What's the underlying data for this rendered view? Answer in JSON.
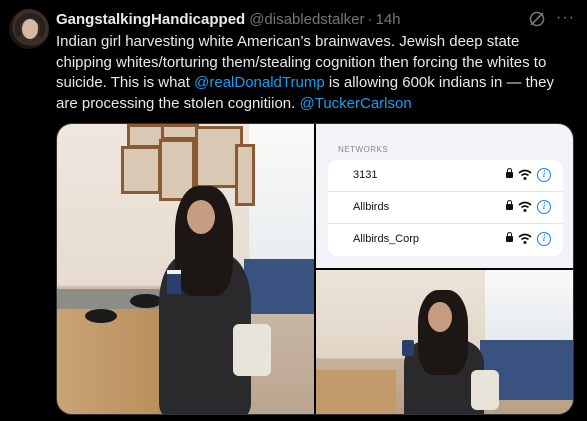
{
  "tweet": {
    "display_name": "GangstalkingHandicapped",
    "handle": "@disabledstalker",
    "separator": "·",
    "time": "14h",
    "more_label": "···",
    "text_part1": "Indian girl harvesting white American’s brainwaves. Jewish deep state chipping whites/torturing them/stealing cognition then forcing the whites to suicide. This is what ",
    "mention1": "@realDonaldTrump",
    "text_part2": " is allowing 600k indians in — they are processing the stolen cognitiion. ",
    "mention2": "@TuckerCarlson"
  },
  "media": {
    "networks_header": "NETWORKS",
    "networks": [
      {
        "name": "3131"
      },
      {
        "name": "Allbirds"
      },
      {
        "name": "Allbirds_Corp"
      }
    ]
  },
  "colors": {
    "background": "#000000",
    "text": "#e7e9ea",
    "muted": "#71767b",
    "link": "#1d9bf0"
  },
  "icons": [
    "grok-icon",
    "more-icon",
    "lock-icon",
    "wifi-icon",
    "info-icon"
  ]
}
